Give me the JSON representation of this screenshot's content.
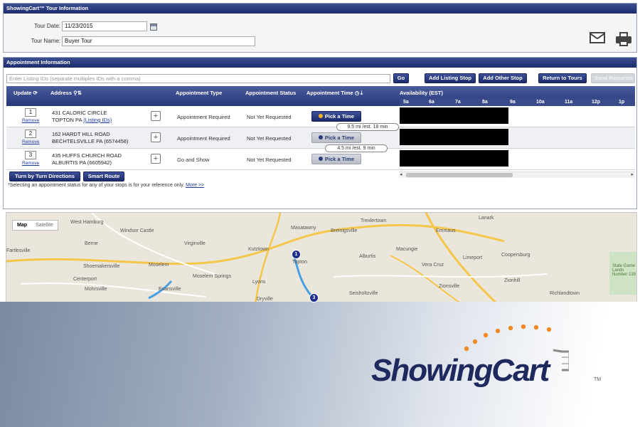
{
  "tour_panel": {
    "title": "ShowingCart™ Tour Information",
    "tour_date_label": "Tour Date:",
    "tour_date_value": "11/23/2015",
    "tour_name_label": "Tour Name:",
    "tour_name_value": "Buyer Tour"
  },
  "appointment_panel": {
    "title": "Appointment Information",
    "listing_placeholder": "Enter Listing IDs (separate multiples IDs with a comma)",
    "buttons": {
      "go": "Go",
      "add_listing_stop": "Add Listing Stop",
      "add_other_stop": "Add Other Stop",
      "return_to_tours": "Return to Tours",
      "send_requests": "Send Requests"
    },
    "columns": {
      "update": "Update ⟳",
      "address": "Address ⚲⇅",
      "appointment_type": "Appointment Type",
      "appointment_status": "Appointment Status",
      "appointment_time": "Appointment Time ◷⇣",
      "availability": "Availability (EST)"
    },
    "hours": [
      "5a",
      "6a",
      "7a",
      "8a",
      "9a",
      "10a",
      "11a",
      "12p",
      "1p"
    ],
    "rows": [
      {
        "number": "1",
        "remove": "Remove",
        "address_line1": "431 CALORIC CIRCLE",
        "address_line2": "TOPTON PA",
        "address_link": "(Listing IDs)",
        "type": "Appointment Required",
        "status": "Not Yet Requested",
        "pick": "Pick a Time"
      },
      {
        "number": "2",
        "remove": "Remove",
        "address_line1": "162 HARDT HILL ROAD",
        "address_line2": "BECHTELSVILLE PA (6574458)",
        "address_link": "",
        "type": "Appointment Required",
        "status": "Not Yet Requested",
        "pick": "Pick a Time"
      },
      {
        "number": "3",
        "remove": "Remove",
        "address_line1": "435 HUFFS CHURCH ROAD",
        "address_line2": "ALBURTIS PA (6605942)",
        "address_link": "",
        "type": "Go and Show",
        "status": "Not Yet Requested",
        "pick": "Pick a Time"
      }
    ],
    "distances": [
      "9.5 mi /est. 18 min",
      "4.5 mi /est. 9 min"
    ],
    "bottom_buttons": {
      "turn_by_turn": "Turn by Turn Directions",
      "smart_route": "Smart Route"
    },
    "footnote": "*Selecting an appointment status for any of your stops is for your reference only.",
    "footnote_link": "More >>"
  },
  "map": {
    "toggle_map": "Map",
    "toggle_satellite": "Satellite",
    "towns": [
      "West Hamburg",
      "Windsor Castle",
      "Virginville",
      "Maxatawny",
      "Breinigsville",
      "Trexlertown",
      "Emmaus",
      "Lanark",
      "Berne",
      "Kutztown",
      "Alburtis",
      "Macungie",
      "Shoemakersville",
      "Moselem",
      "Limeport",
      "Coopersburg",
      "Centerport",
      "Moselem Springs",
      "Lyons",
      "Vera Cruz",
      "Mohrsville",
      "Evansville",
      "Seisholtzville",
      "Zionsville",
      "Zionhill",
      "Richlandtown",
      "Dryville",
      "State Game Lands Number 139",
      "Topton",
      "Fartlesville"
    ],
    "markers": [
      "1",
      "3"
    ],
    "route_badges": [
      "222",
      "737",
      "100",
      "29",
      "663",
      "476",
      "309"
    ]
  },
  "brand": {
    "logo_text": "ShowingCart",
    "tm": "TM"
  },
  "colors": {
    "header_navy": "#1c2c6b",
    "button_navy": "#1b2a68",
    "accent_orange": "#f08a24",
    "map_road_yellow": "#f4c64a",
    "route_blue": "#4aa0e0"
  }
}
